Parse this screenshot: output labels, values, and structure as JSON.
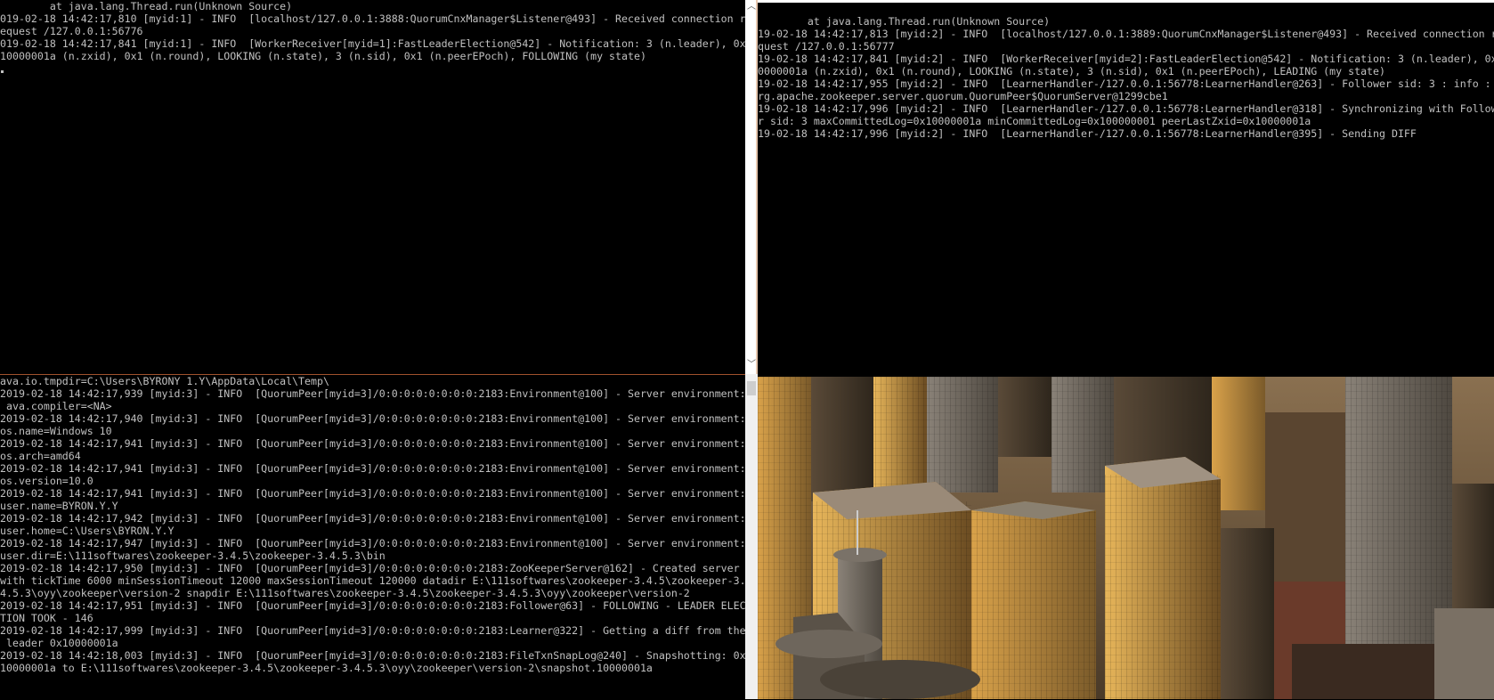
{
  "consoles": {
    "node1": {
      "lines": "        at java.lang.Thread.run(Unknown Source)\n019-02-18 14:42:17,810 [myid:1] - INFO  [localhost/127.0.0.1:3888:QuorumCnxManager$Listener@493] - Received connection r\nequest /127.0.0.1:56776\n019-02-18 14:42:17,841 [myid:1] - INFO  [WorkerReceiver[myid=1]:FastLeaderElection@542] - Notification: 3 (n.leader), 0x\n10000001a (n.zxid), 0x1 (n.round), LOOKING (n.state), 3 (n.sid), 0x1 (n.peerEPoch), FOLLOWING (my state)"
    },
    "node2": {
      "lines": "\n        at java.lang.Thread.run(Unknown Source)\n19-02-18 14:42:17,813 [myid:2] - INFO  [localhost/127.0.0.1:3889:QuorumCnxManager$Listener@493] - Received connection r\nquest /127.0.0.1:56777\n19-02-18 14:42:17,841 [myid:2] - INFO  [WorkerReceiver[myid=2]:FastLeaderElection@542] - Notification: 3 (n.leader), 0x\n0000001a (n.zxid), 0x1 (n.round), LOOKING (n.state), 3 (n.sid), 0x1 (n.peerEPoch), LEADING (my state)\n19-02-18 14:42:17,955 [myid:2] - INFO  [LearnerHandler-/127.0.0.1:56778:LearnerHandler@263] - Follower sid: 3 : info : o\nrg.apache.zookeeper.server.quorum.QuorumPeer$QuorumServer@1299cbe1\n19-02-18 14:42:17,996 [myid:2] - INFO  [LearnerHandler-/127.0.0.1:56778:LearnerHandler@318] - Synchronizing with Follow\nr sid: 3 maxCommittedLog=0x10000001a minCommittedLog=0x100000001 peerLastZxid=0x10000001a\n19-02-18 14:42:17,996 [myid:2] - INFO  [LearnerHandler-/127.0.0.1:56778:LearnerHandler@395] - Sending DIFF"
    },
    "node3": {
      "lines": "ava.io.tmpdir=C:\\Users\\BYRONY 1.Y\\AppData\\Local\\Temp\\\n2019-02-18 14:42:17,939 [myid:3] - INFO  [QuorumPeer[myid=3]/0:0:0:0:0:0:0:0:2183:Environment@100] - Server environment:\n ava.compiler=<NA>\n2019-02-18 14:42:17,940 [myid:3] - INFO  [QuorumPeer[myid=3]/0:0:0:0:0:0:0:0:2183:Environment@100] - Server environment:\nos.name=Windows 10\n2019-02-18 14:42:17,941 [myid:3] - INFO  [QuorumPeer[myid=3]/0:0:0:0:0:0:0:0:2183:Environment@100] - Server environment:\nos.arch=amd64\n2019-02-18 14:42:17,941 [myid:3] - INFO  [QuorumPeer[myid=3]/0:0:0:0:0:0:0:0:2183:Environment@100] - Server environment:\nos.version=10.0\n2019-02-18 14:42:17,941 [myid:3] - INFO  [QuorumPeer[myid=3]/0:0:0:0:0:0:0:0:2183:Environment@100] - Server environment:\nuser.name=BYRON.Y.Y\n2019-02-18 14:42:17,942 [myid:3] - INFO  [QuorumPeer[myid=3]/0:0:0:0:0:0:0:0:2183:Environment@100] - Server environment:\nuser.home=C:\\Users\\BYRON.Y.Y\n2019-02-18 14:42:17,947 [myid:3] - INFO  [QuorumPeer[myid=3]/0:0:0:0:0:0:0:0:2183:Environment@100] - Server environment:\nuser.dir=E:\\111softwares\\zookeeper-3.4.5\\zookeeper-3.4.5.3\\bin\n2019-02-18 14:42:17,950 [myid:3] - INFO  [QuorumPeer[myid=3]/0:0:0:0:0:0:0:0:2183:ZooKeeperServer@162] - Created server\nwith tickTime 6000 minSessionTimeout 12000 maxSessionTimeout 120000 datadir E:\\111softwares\\zookeeper-3.4.5\\zookeeper-3.\n4.5.3\\oyy\\zookeeper\\version-2 snapdir E:\\111softwares\\zookeeper-3.4.5\\zookeeper-3.4.5.3\\oyy\\zookeeper\\version-2\n2019-02-18 14:42:17,951 [myid:3] - INFO  [QuorumPeer[myid=3]/0:0:0:0:0:0:0:0:2183:Follower@63] - FOLLOWING - LEADER ELEC\nTION TOOK - 146\n2019-02-18 14:42:17,999 [myid:3] - INFO  [QuorumPeer[myid=3]/0:0:0:0:0:0:0:0:2183:Learner@322] - Getting a diff from the\n leader 0x10000001a\n2019-02-18 14:42:18,003 [myid:3] - INFO  [QuorumPeer[myid=3]/0:0:0:0:0:0:0:0:2183:FileTxnSnapLog@240] - Snapshotting: 0x\n10000001a to E:\\111softwares\\zookeeper-3.4.5\\zookeeper-3.4.5.3\\oyy\\zookeeper\\version-2\\snapshot.10000001a"
    }
  },
  "scrollbar": {
    "up_arrow_icon": "chevron-up-icon",
    "down_arrow_icon": "chevron-down-icon",
    "up_glyph": "︿",
    "down_glyph": "﹀"
  },
  "colors": {
    "console_bg": "#000000",
    "console_text": "#c0c0c0",
    "splitter": "#ffffff"
  }
}
